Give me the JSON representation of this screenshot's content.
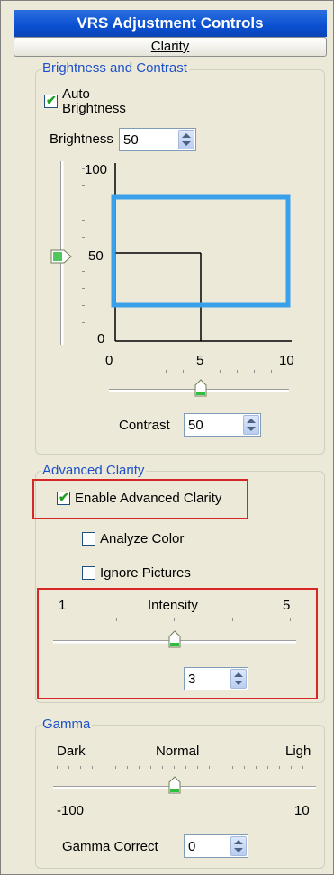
{
  "title": "VRS Adjustment Controls",
  "tab_button": "Clarity",
  "brightness_contrast": {
    "legend": "Brightness and Contrast",
    "auto_brightness_line1": "Auto",
    "auto_brightness_line2": "Brightness",
    "auto_brightness_checked": true,
    "brightness_label": "Brightness",
    "brightness_value": "50",
    "y_labels": [
      "100",
      "50",
      "0"
    ],
    "x_labels": [
      "0",
      "5",
      "10"
    ],
    "contrast_label": "Contrast",
    "contrast_value": "50",
    "brightness_slider_level": 50,
    "contrast_slider_level": 50,
    "graph_rect_color": "#3aa0ea"
  },
  "advanced_clarity": {
    "legend": "Advanced Clarity",
    "enable_label": "Enable Advanced Clarity",
    "enable_checked": true,
    "analyze_color_label": "Analyze Color",
    "analyze_color_checked": false,
    "ignore_pictures_label": "Ignore Pictures",
    "ignore_pictures_checked": false,
    "intensity_min": "1",
    "intensity_label": "Intensity",
    "intensity_max": "5",
    "intensity_value": "3",
    "highlight_color": "#d62626"
  },
  "gamma": {
    "legend": "Gamma",
    "dark_label": "Dark",
    "normal_label": "Normal",
    "light_label": "Ligh",
    "min_label": "-100",
    "max_label": "10",
    "gamma_correct_label": "Gamma Correct",
    "gamma_correct_value": "0"
  }
}
